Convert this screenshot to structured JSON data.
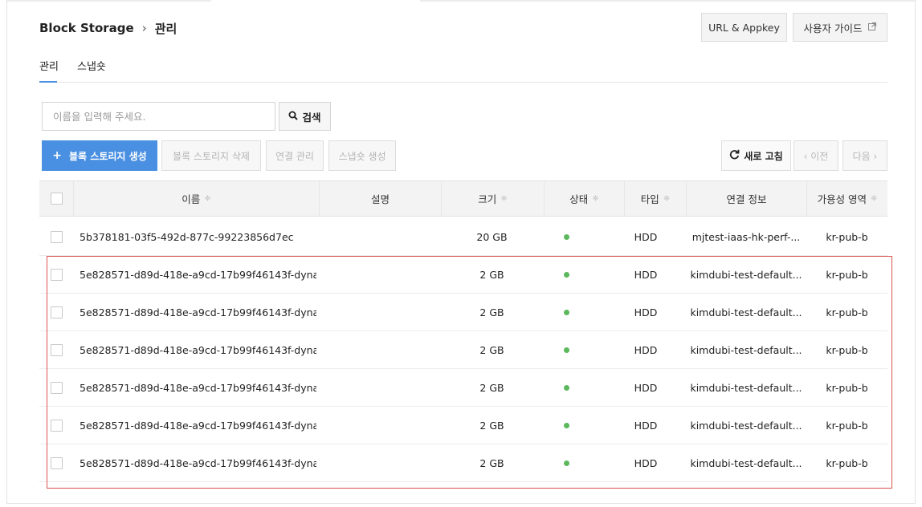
{
  "breadcrumb": {
    "service": "Block Storage",
    "separator": "›",
    "page": "관리"
  },
  "header_buttons": {
    "url_appkey": "URL & Appkey",
    "user_guide": "사용자 가이드"
  },
  "tabs": [
    {
      "label": "관리",
      "active": true
    },
    {
      "label": "스냅숏",
      "active": false
    }
  ],
  "search": {
    "placeholder": "이름을 입력해 주세요.",
    "value": "",
    "button_label": "검색"
  },
  "actions": {
    "create": "블록 스토리지 생성",
    "delete": "블록 스토리지 삭제",
    "connect": "연결 관리",
    "snapshot": "스냅숏 생성",
    "refresh": "새로 고침",
    "prev": "‹ 이전",
    "next": "다음 ›"
  },
  "table": {
    "columns": [
      {
        "label": "이름",
        "sortable": true
      },
      {
        "label": "설명",
        "sortable": false
      },
      {
        "label": "크기",
        "sortable": true
      },
      {
        "label": "상태",
        "sortable": true
      },
      {
        "label": "타입",
        "sortable": true
      },
      {
        "label": "연결 정보",
        "sortable": false
      },
      {
        "label": "가용성 영역",
        "sortable": true
      }
    ],
    "sort_glyph": "≑",
    "rows": [
      {
        "name": "5b378181-03f5-492d-877c-99223856d7ec",
        "description": "",
        "size": "20 GB",
        "status": "active",
        "type": "HDD",
        "attachment": "mjtest-iaas-hk-perf-...",
        "zone": "kr-pub-b"
      },
      {
        "name": "5e828571-d89d-418e-a9cd-17b99f46143f-dyna...",
        "description": "",
        "size": "2 GB",
        "status": "active",
        "type": "HDD",
        "attachment": "kimdubi-test-default...",
        "zone": "kr-pub-b"
      },
      {
        "name": "5e828571-d89d-418e-a9cd-17b99f46143f-dyna...",
        "description": "",
        "size": "2 GB",
        "status": "active",
        "type": "HDD",
        "attachment": "kimdubi-test-default...",
        "zone": "kr-pub-b"
      },
      {
        "name": "5e828571-d89d-418e-a9cd-17b99f46143f-dyna...",
        "description": "",
        "size": "2 GB",
        "status": "active",
        "type": "HDD",
        "attachment": "kimdubi-test-default...",
        "zone": "kr-pub-b"
      },
      {
        "name": "5e828571-d89d-418e-a9cd-17b99f46143f-dyna...",
        "description": "",
        "size": "2 GB",
        "status": "active",
        "type": "HDD",
        "attachment": "kimdubi-test-default...",
        "zone": "kr-pub-b"
      },
      {
        "name": "5e828571-d89d-418e-a9cd-17b99f46143f-dyna...",
        "description": "",
        "size": "2 GB",
        "status": "active",
        "type": "HDD",
        "attachment": "kimdubi-test-default...",
        "zone": "kr-pub-b"
      },
      {
        "name": "5e828571-d89d-418e-a9cd-17b99f46143f-dyna...",
        "description": "",
        "size": "2 GB",
        "status": "active",
        "type": "HDD",
        "attachment": "kimdubi-test-default...",
        "zone": "kr-pub-b"
      }
    ]
  },
  "colors": {
    "accent": "#4a90e2",
    "status_active": "#5cb85c",
    "highlight_border": "#d9534f"
  },
  "icons": {
    "search": "search-icon",
    "refresh": "refresh-icon",
    "external": "external-link-icon"
  }
}
